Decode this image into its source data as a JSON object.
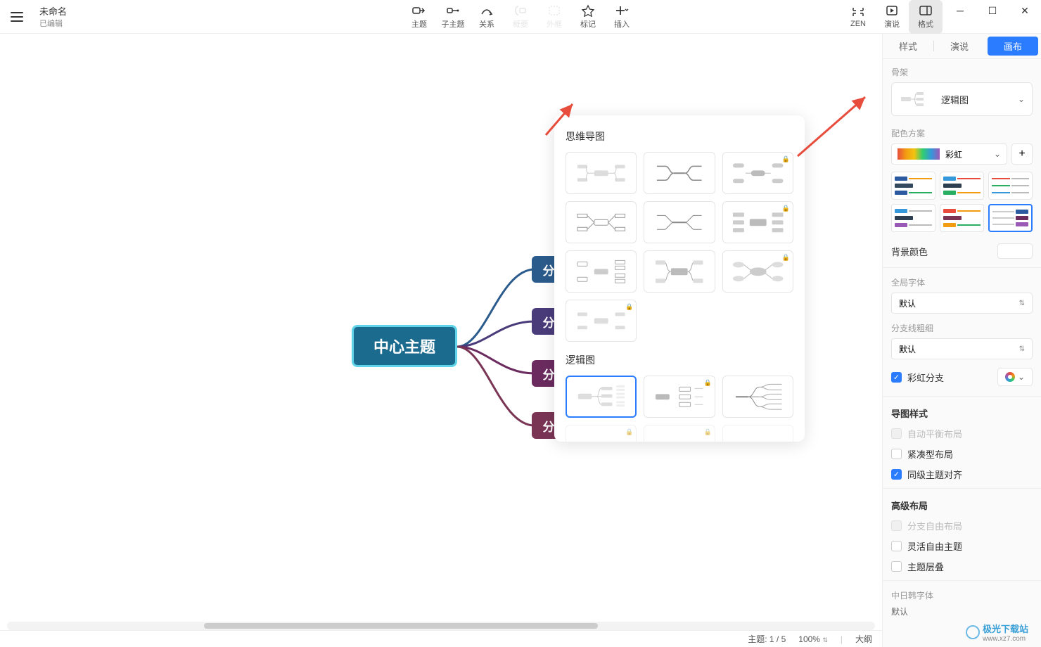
{
  "document": {
    "title": "未命名",
    "status": "已编辑"
  },
  "toolbar": {
    "topic": "主题",
    "subtopic": "子主题",
    "relation": "关系",
    "summary": "概要",
    "boundary": "外框",
    "marker": "标记",
    "insert": "插入",
    "zen": "ZEN",
    "pitch": "演说",
    "format": "格式"
  },
  "canvas": {
    "central": "中心主题",
    "branches": [
      "分",
      "分",
      "分",
      "分"
    ]
  },
  "popup": {
    "section1": "思维导图",
    "section2": "逻辑图"
  },
  "panel": {
    "tabs": {
      "style": "样式",
      "pitch": "演说",
      "canvas": "画布"
    },
    "skeleton_label": "骨架",
    "skeleton_value": "逻辑图",
    "color_scheme_label": "配色方案",
    "color_scheme_value": "彩虹",
    "bg_color": "背景颜色",
    "global_font_label": "全局字体",
    "global_font_value": "默认",
    "branch_width_label": "分支线粗细",
    "branch_width_value": "默认",
    "rainbow_branch": "彩虹分支",
    "map_style_header": "导图样式",
    "auto_balance": "自动平衡布局",
    "compact": "紧凑型布局",
    "align_siblings": "同级主题对齐",
    "advanced_header": "高级布局",
    "free_branch": "分支自由布局",
    "flex_topic": "灵活自由主题",
    "topic_overlap": "主题层叠",
    "cjk_font_label": "中日韩字体",
    "cjk_font_value": "默认"
  },
  "footer": {
    "topic_count": "主题: 1 / 5",
    "zoom": "100%",
    "outline": "大纲"
  },
  "watermark": {
    "text": "极光下载站",
    "url": "www.xz7.com"
  }
}
